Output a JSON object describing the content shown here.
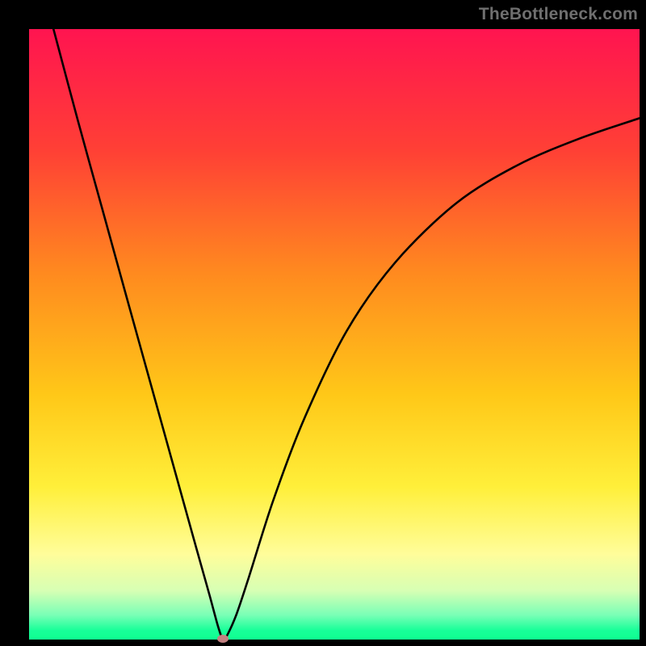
{
  "watermark": "TheBottleneck.com",
  "chart_data": {
    "type": "line",
    "title": "",
    "xlabel": "",
    "ylabel": "",
    "xlim": [
      0,
      100
    ],
    "ylim": [
      0,
      100
    ],
    "gradient_stops": [
      {
        "offset": 0.0,
        "color": "#ff1450"
      },
      {
        "offset": 0.2,
        "color": "#ff4035"
      },
      {
        "offset": 0.4,
        "color": "#ff8a1f"
      },
      {
        "offset": 0.6,
        "color": "#ffc818"
      },
      {
        "offset": 0.75,
        "color": "#ffef3a"
      },
      {
        "offset": 0.86,
        "color": "#fffd9a"
      },
      {
        "offset": 0.92,
        "color": "#d7ffb4"
      },
      {
        "offset": 0.96,
        "color": "#79ffb6"
      },
      {
        "offset": 0.985,
        "color": "#18ff99"
      },
      {
        "offset": 1.0,
        "color": "#0fff90"
      }
    ],
    "series": [
      {
        "name": "bottleneck-curve",
        "x": [
          4,
          8,
          12,
          16,
          20,
          24,
          27,
          29.5,
          31,
          31.8,
          32.5,
          34,
          36,
          40,
          45,
          52,
          60,
          70,
          80,
          90,
          100
        ],
        "y": [
          100,
          85,
          70.5,
          56,
          41.6,
          27.2,
          16.4,
          7.5,
          2.0,
          0.0,
          0.8,
          4.2,
          10.2,
          22.8,
          36.0,
          50.5,
          61.8,
          71.5,
          77.7,
          82.0,
          85.4
        ]
      }
    ],
    "marker": {
      "x": 31.8,
      "y": 0.0
    }
  }
}
